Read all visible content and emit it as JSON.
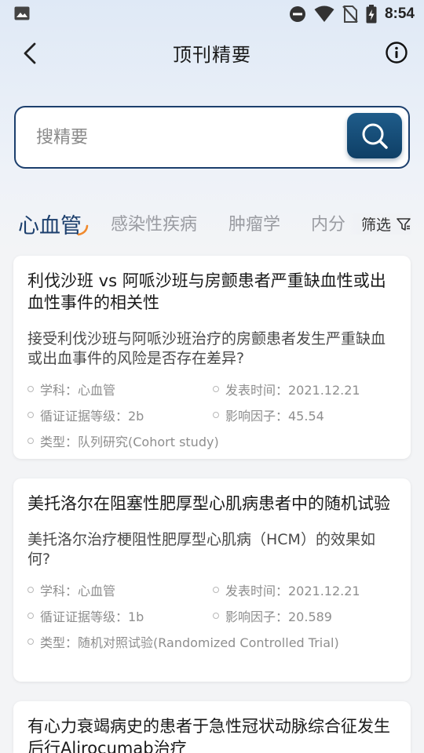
{
  "status_bar": {
    "time": "8:54",
    "icons": [
      "image-icon",
      "dnd-icon",
      "wifi-icon",
      "no-sim-icon",
      "battery-charging-icon"
    ]
  },
  "header": {
    "title": "顶刊精要",
    "back_icon": "chevron-left-icon",
    "info_icon": "info-icon"
  },
  "search": {
    "placeholder": "搜精要",
    "value": "",
    "button_icon": "search-icon"
  },
  "tabs": [
    {
      "label": "心血管",
      "active": true
    },
    {
      "label": "感染性疾病",
      "active": false
    },
    {
      "label": "肿瘤学",
      "active": false
    },
    {
      "label": "内分",
      "active": false
    }
  ],
  "filter": {
    "label": "筛选",
    "icon": "filter-icon"
  },
  "colors": {
    "accent": "#1c3f6d",
    "tab_underline": "#f08a2e",
    "muted": "#8e8e8e"
  },
  "cards": [
    {
      "title": "利伐沙班 vs 阿哌沙班与房颤患者严重缺血性或出血性事件的相关性",
      "question": "接受利伐沙班与阿哌沙班治疗的房颤患者发生严重缺血或出血事件的风险是否存在差异?",
      "subject": "学科：心血管",
      "date": "发表时间：2021.12.21",
      "evidence": "循证证据等级：2b",
      "impact": "影响因子：45.54",
      "type": "类型：队列研究(Cohort study)"
    },
    {
      "title": "美托洛尔在阻塞性肥厚型心肌病患者中的随机试验",
      "question": "美托洛尔治疗梗阻性肥厚型心肌病（HCM）的效果如何?",
      "subject": "学科：心血管",
      "date": "发表时间：2021.12.21",
      "evidence": "循证证据等级：1b",
      "impact": "影响因子：20.589",
      "type": "类型：随机对照试验(Randomized Controlled Trial)"
    },
    {
      "title": "有心力衰竭病史的患者于急性冠状动脉综合征发生后行Alirocumab治疗"
    }
  ]
}
